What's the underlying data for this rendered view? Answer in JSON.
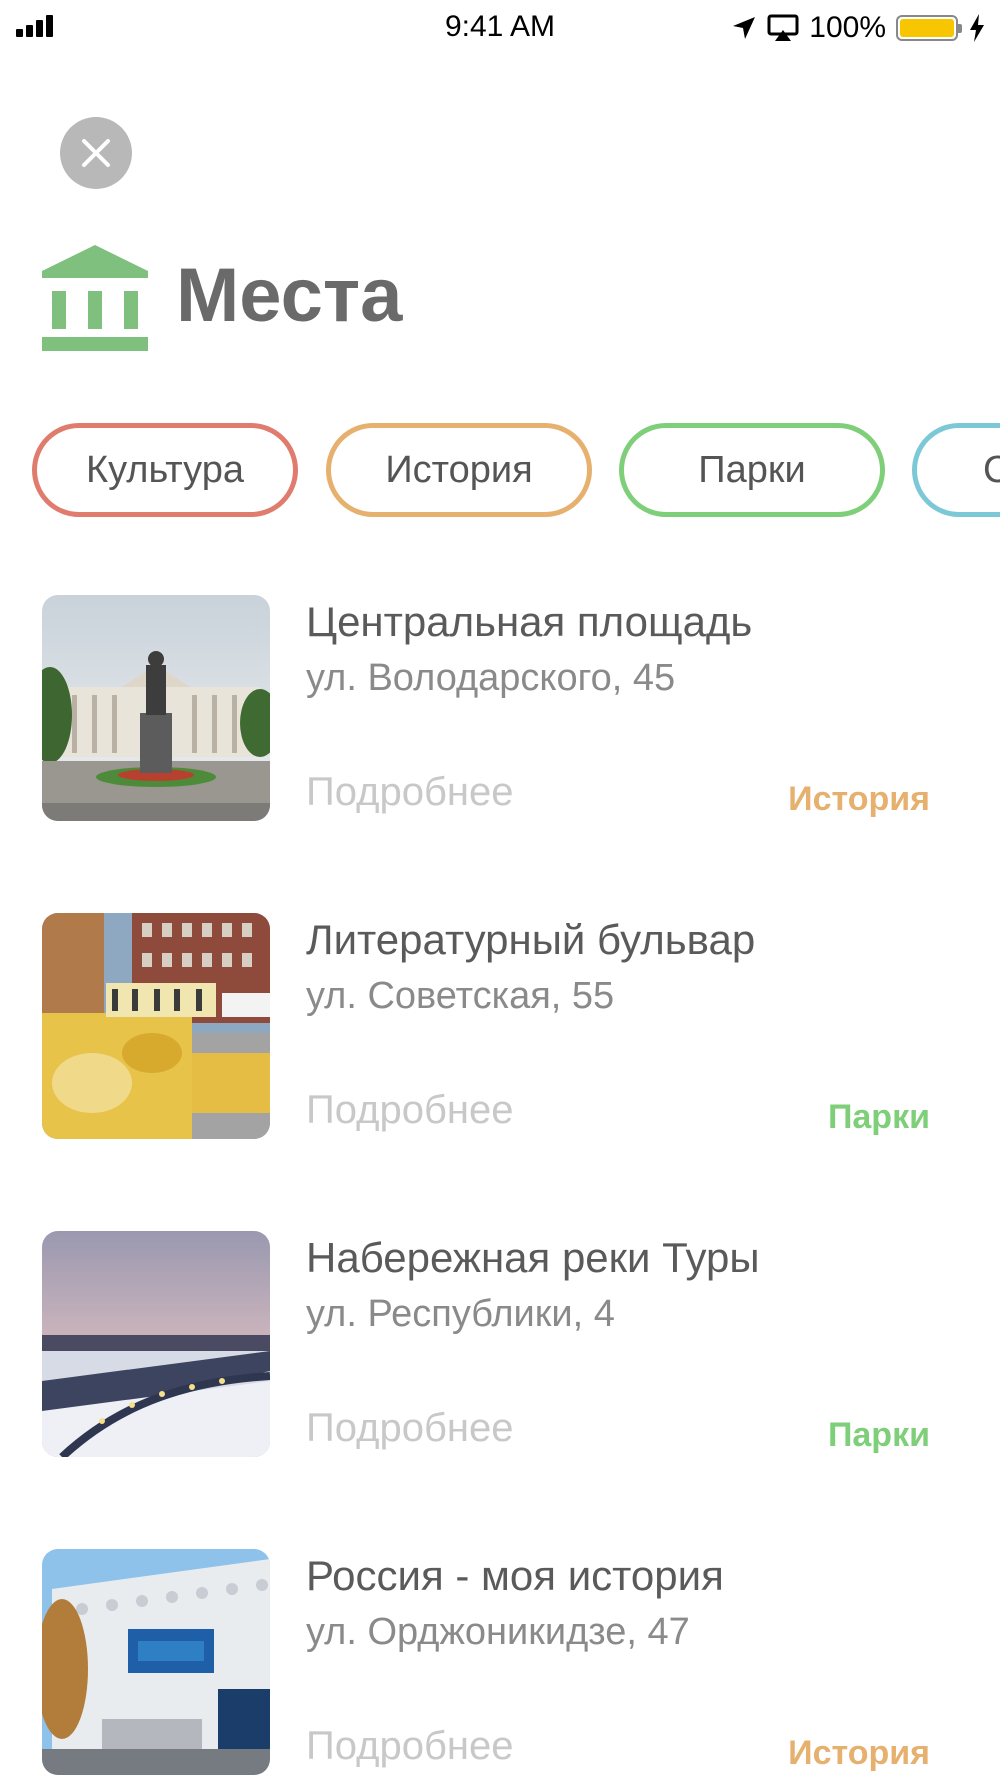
{
  "status_bar": {
    "time": "9:41 AM",
    "battery_percent": "100%",
    "battery_level": 1.0,
    "icons": [
      "signal-icon",
      "location-arrow-icon",
      "airplay-icon",
      "battery-icon",
      "charging-bolt-icon"
    ]
  },
  "header": {
    "close_icon": "close-icon",
    "icon": "museum-building-icon",
    "icon_color": "#7fc07f",
    "title": "Места"
  },
  "filters": [
    {
      "label": "Культура",
      "color": "#e07c6e"
    },
    {
      "label": "История",
      "color": "#e6b06f"
    },
    {
      "label": "Парки",
      "color": "#7fcf7a"
    },
    {
      "label": "С",
      "color": "#7cc8d6"
    }
  ],
  "places": [
    {
      "name": "Центральная площадь",
      "address": "ул. Володарского, 45",
      "more": "Подробнее",
      "category": "История",
      "category_color": "#e6b06f"
    },
    {
      "name": "Литературный бульвар",
      "address": "ул. Советская, 55",
      "more": "Подробнее",
      "category": "Парки",
      "category_color": "#7fcf7a"
    },
    {
      "name": "Набережная реки Туры",
      "address": "ул. Республики, 4",
      "more": "Подробнее",
      "category": "Парки",
      "category_color": "#7fcf7a"
    },
    {
      "name": "Россия - моя история",
      "address": "ул. Орджоникидзе, 47",
      "more": "Подробнее",
      "category": "История",
      "category_color": "#e6b06f"
    }
  ]
}
